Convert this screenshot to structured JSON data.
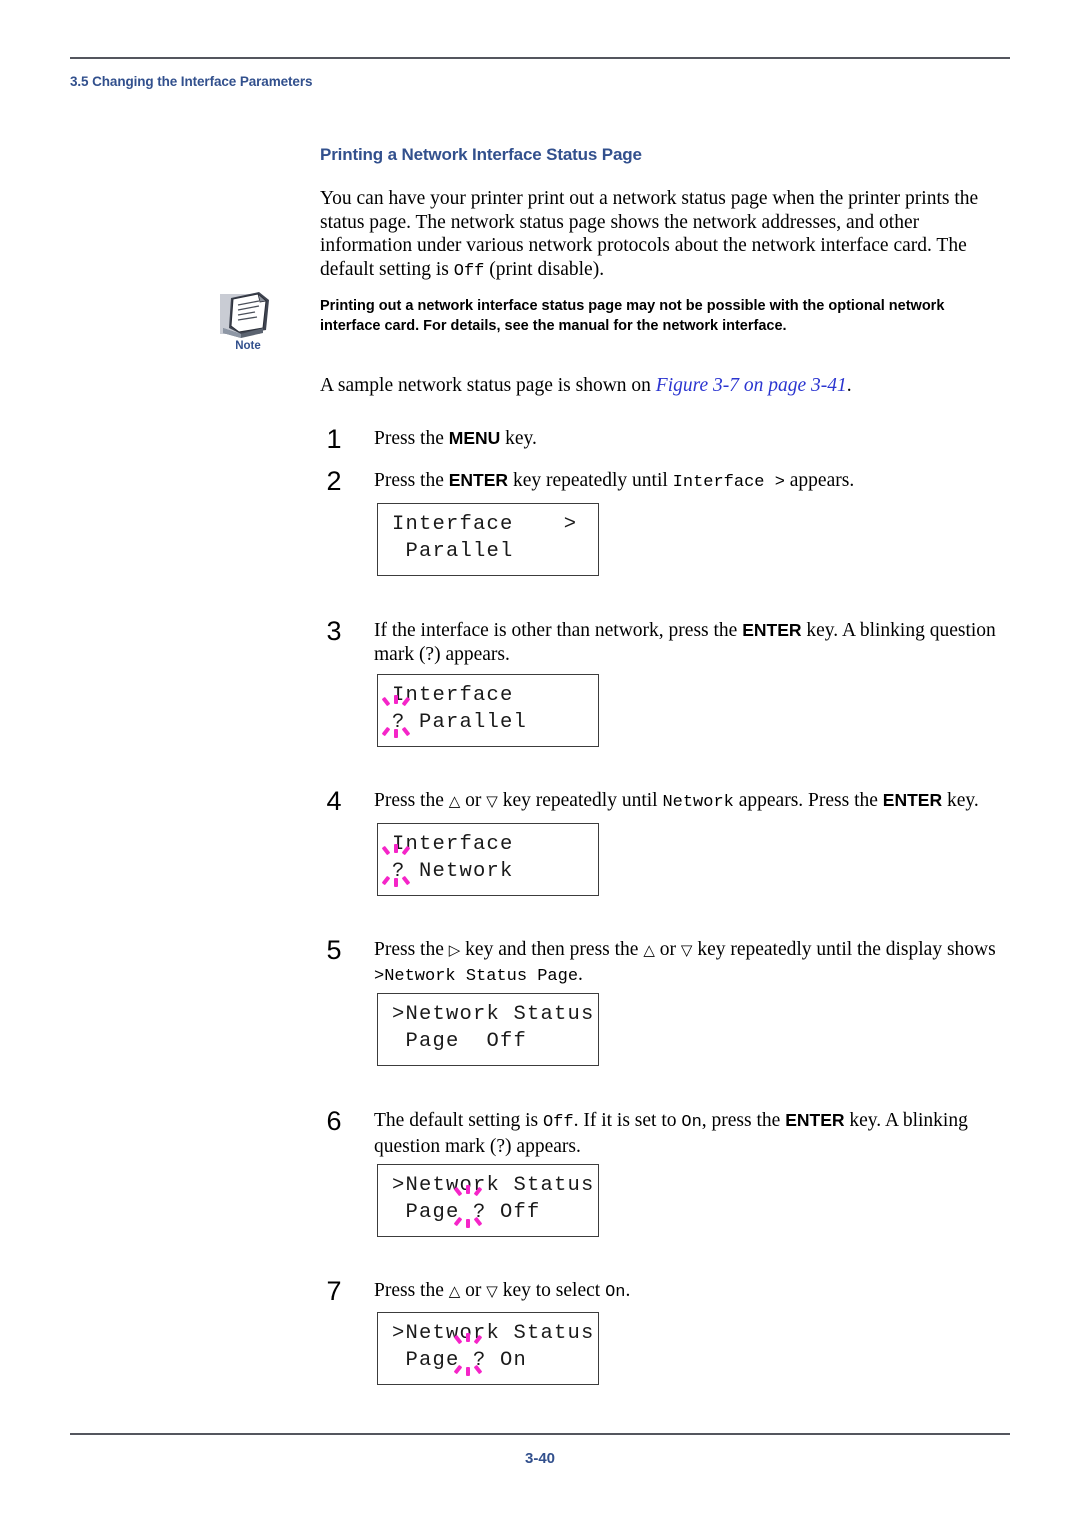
{
  "header": {
    "running_head": "3.5 Changing the Interface Parameters"
  },
  "section": {
    "title": "Printing a Network Interface Status Page",
    "intro_part1": "You can have your printer print out a network status page when the printer prints the status page. The network status page shows the network addresses, and other information under various network protocols about the network interface card. The default setting is ",
    "intro_mono": "Off",
    "intro_part2": " (print disable)."
  },
  "note": {
    "icon": "note-book-icon",
    "label": "Note",
    "text": "Printing out a network interface status page may not be possible with the optional network interface card. For details, see the manual for the network interface."
  },
  "xref": {
    "lead": "A sample network status page is shown on ",
    "link": "Figure 3-7 on page 3-41",
    "trail": "."
  },
  "steps": [
    {
      "number": "1",
      "text_parts": [
        {
          "type": "plain",
          "value": "Press the "
        },
        {
          "type": "bold",
          "value": "MENU"
        },
        {
          "type": "plain",
          "value": " key."
        }
      ]
    },
    {
      "number": "2",
      "text_parts": [
        {
          "type": "plain",
          "value": "Press the "
        },
        {
          "type": "bold",
          "value": "ENTER"
        },
        {
          "type": "plain",
          "value": " key repeatedly until "
        },
        {
          "type": "mono",
          "value": "Interface >"
        },
        {
          "type": "plain",
          "value": " appears."
        }
      ]
    },
    {
      "number": "3",
      "text_parts": [
        {
          "type": "plain",
          "value": "If the interface is other than network, press the "
        },
        {
          "type": "bold",
          "value": "ENTER"
        },
        {
          "type": "plain",
          "value": " key. A blinking question mark (?) appears."
        }
      ]
    },
    {
      "number": "4",
      "text_parts": [
        {
          "type": "plain",
          "value": "Press the "
        },
        {
          "type": "tri",
          "value": "△"
        },
        {
          "type": "plain",
          "value": " or "
        },
        {
          "type": "tri",
          "value": "▽"
        },
        {
          "type": "plain",
          "value": " key repeatedly until "
        },
        {
          "type": "mono",
          "value": "Network"
        },
        {
          "type": "plain",
          "value": " appears. Press the "
        },
        {
          "type": "bold",
          "value": "ENTER"
        },
        {
          "type": "plain",
          "value": " key."
        }
      ]
    },
    {
      "number": "5",
      "text_parts": [
        {
          "type": "plain",
          "value": "Press the "
        },
        {
          "type": "tri",
          "value": "▷"
        },
        {
          "type": "plain",
          "value": " key and then press the "
        },
        {
          "type": "tri",
          "value": "△"
        },
        {
          "type": "plain",
          "value": " or "
        },
        {
          "type": "tri",
          "value": "▽"
        },
        {
          "type": "plain",
          "value": " key repeatedly until the display shows "
        },
        {
          "type": "mono",
          "value": ">Network Status Page"
        },
        {
          "type": "plain",
          "value": "."
        }
      ]
    },
    {
      "number": "6",
      "text_parts": [
        {
          "type": "plain",
          "value": "The default setting is "
        },
        {
          "type": "mono",
          "value": "Off"
        },
        {
          "type": "plain",
          "value": ". If it is set to "
        },
        {
          "type": "mono",
          "value": "On"
        },
        {
          "type": "plain",
          "value": ", press the "
        },
        {
          "type": "bold",
          "value": "ENTER"
        },
        {
          "type": "plain",
          "value": " key. A blinking question mark (?) appears."
        }
      ]
    },
    {
      "number": "7",
      "text_parts": [
        {
          "type": "plain",
          "value": "Press the "
        },
        {
          "type": "tri",
          "value": "△"
        },
        {
          "type": "plain",
          "value": " or "
        },
        {
          "type": "tri",
          "value": "▽"
        },
        {
          "type": "plain",
          "value": " key to select "
        },
        {
          "type": "mono",
          "value": "On"
        },
        {
          "type": "plain",
          "value": "."
        }
      ]
    }
  ],
  "displays": [
    {
      "id": "display-interface-parallel",
      "line1": "Interface",
      "line1_right": ">",
      "line2": " Parallel",
      "blinking": false
    },
    {
      "id": "display-interface-parallel-query",
      "line1": "Interface",
      "line1_right": "",
      "line2": "? Parallel",
      "blinking": true
    },
    {
      "id": "display-interface-network-query",
      "line1": "Interface",
      "line1_right": "",
      "line2": "? Network",
      "blinking": true
    },
    {
      "id": "display-network-status-page-off",
      "line1": ">Network Status",
      "line1_right": "",
      "line2": " Page  Off",
      "blinking": false
    },
    {
      "id": "display-network-status-page-query-off",
      "line1": ">Network Status",
      "line1_right": "",
      "line2": " Page ? Off",
      "blinking": true
    },
    {
      "id": "display-network-status-page-query-on",
      "line1": ">Network Status",
      "line1_right": "",
      "line2": " Page ? On",
      "blinking": true
    }
  ],
  "footer": {
    "page_number": "3-40"
  },
  "colors": {
    "heading_blue": "#32508d",
    "xref_blue": "#2b35d0",
    "blink_magenta": "#f525c8",
    "rule_gray": "#54565e"
  }
}
